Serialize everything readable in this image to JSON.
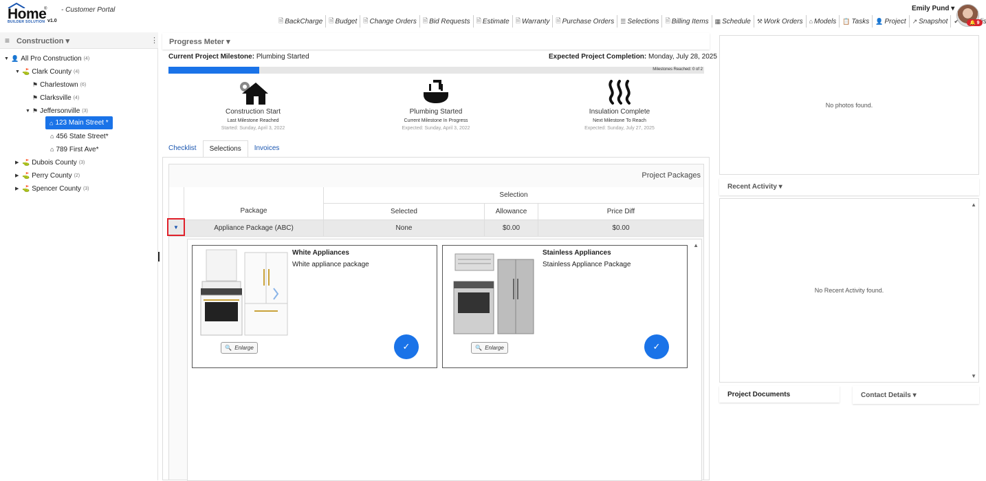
{
  "header": {
    "logo_text": "Home",
    "logo_sub": "BUILDER SOLUTION",
    "logo_version": "v1.0",
    "portal_label": "- Customer Portal",
    "user_name": "Emily Pund ▾",
    "notification_count": "9",
    "nav": [
      {
        "label": "BackCharge",
        "icon": "document-icon"
      },
      {
        "label": "Budget",
        "icon": "document-icon"
      },
      {
        "label": "Change Orders",
        "icon": "document-icon"
      },
      {
        "label": "Bid Requests",
        "icon": "document-icon"
      },
      {
        "label": "Estimate",
        "icon": "document-icon"
      },
      {
        "label": "Warranty",
        "icon": "document-icon"
      },
      {
        "label": "Purchase Orders",
        "icon": "document-icon"
      },
      {
        "label": "Selections",
        "icon": "list-icon"
      },
      {
        "label": "Billing Items",
        "icon": "document-icon"
      },
      {
        "label": "Schedule",
        "icon": "calendar-icon"
      },
      {
        "label": "Work Orders",
        "icon": "worker-icon"
      },
      {
        "label": "Models",
        "icon": "house-icon"
      },
      {
        "label": "Tasks",
        "icon": "clipboard-icon"
      },
      {
        "label": "Project",
        "icon": "person-icon"
      },
      {
        "label": "Snapshot",
        "icon": "chart-icon"
      },
      {
        "label": "Checklist",
        "icon": "check-icon"
      }
    ]
  },
  "left_panel": {
    "title": "Construction ▾",
    "tree": {
      "root": {
        "label": "All Pro Construction",
        "count": "(4)"
      },
      "clark": {
        "label": "Clark County",
        "count": "(4)"
      },
      "charlestown": {
        "label": "Charlestown",
        "count": "(6)"
      },
      "clarksville": {
        "label": "Clarksville",
        "count": "(4)"
      },
      "jeffersonville": {
        "label": "Jeffersonville",
        "count": "(3)"
      },
      "main_street": {
        "label": "123 Main Street *"
      },
      "state_street": {
        "label": "456 State Street*"
      },
      "first_ave": {
        "label": "789 First Ave*"
      },
      "dubois": {
        "label": "Dubois County",
        "count": "(3)"
      },
      "perry": {
        "label": "Perry County",
        "count": "(2)"
      },
      "spencer": {
        "label": "Spencer County",
        "count": "(3)"
      }
    }
  },
  "progress": {
    "title": "Progress Meter ▾",
    "current_label": "Current Project Milestone:",
    "current_value": "Plumbing Started",
    "expected_label": "Expected Project Completion:",
    "expected_value": "Monday, July 28, 2025",
    "milestones_reached": "Milestones Reached: 0 of 2",
    "fill_fraction": 0.17,
    "milestones": [
      {
        "name": "Construction Start",
        "status": "Last Milestone Reached",
        "date": "Started: Sunday, April 3, 2022",
        "icon": "house-gear-icon"
      },
      {
        "name": "Plumbing Started",
        "status": "Current Milestone In Progress",
        "date": "Expected: Sunday, April 3, 2022",
        "icon": "sink-icon"
      },
      {
        "name": "Insulation Complete",
        "status": "Next Milestone To Reach",
        "date": "Expected: Sunday, July 27, 2025",
        "icon": "heat-icon"
      }
    ]
  },
  "tabs": {
    "checklist": "Checklist",
    "selections": "Selections",
    "invoices": "Invoices"
  },
  "selections": {
    "caption": "Project Packages",
    "group_header": "Selection",
    "col_package": "Package",
    "col_selected": "Selected",
    "col_allowance": "Allowance",
    "col_price_diff": "Price Diff",
    "row": {
      "package": "Appliance Package (ABC)",
      "selected": "None",
      "allowance": "$0.00",
      "price_diff": "$0.00"
    },
    "cards": [
      {
        "title": "White Appliances",
        "description": "White appliance package",
        "enlarge": "Enlarge"
      },
      {
        "title": "Stainless Appliances",
        "description": "Stainless Appliance Package",
        "enlarge": "Enlarge"
      }
    ]
  },
  "right_panel": {
    "no_photos": "No photos found.",
    "recent_activity_title": "Recent Activity ▾",
    "no_activity": "No Recent Activity found.",
    "project_documents_title": "Project Documents",
    "contact_details_title": "Contact Details ▾"
  }
}
